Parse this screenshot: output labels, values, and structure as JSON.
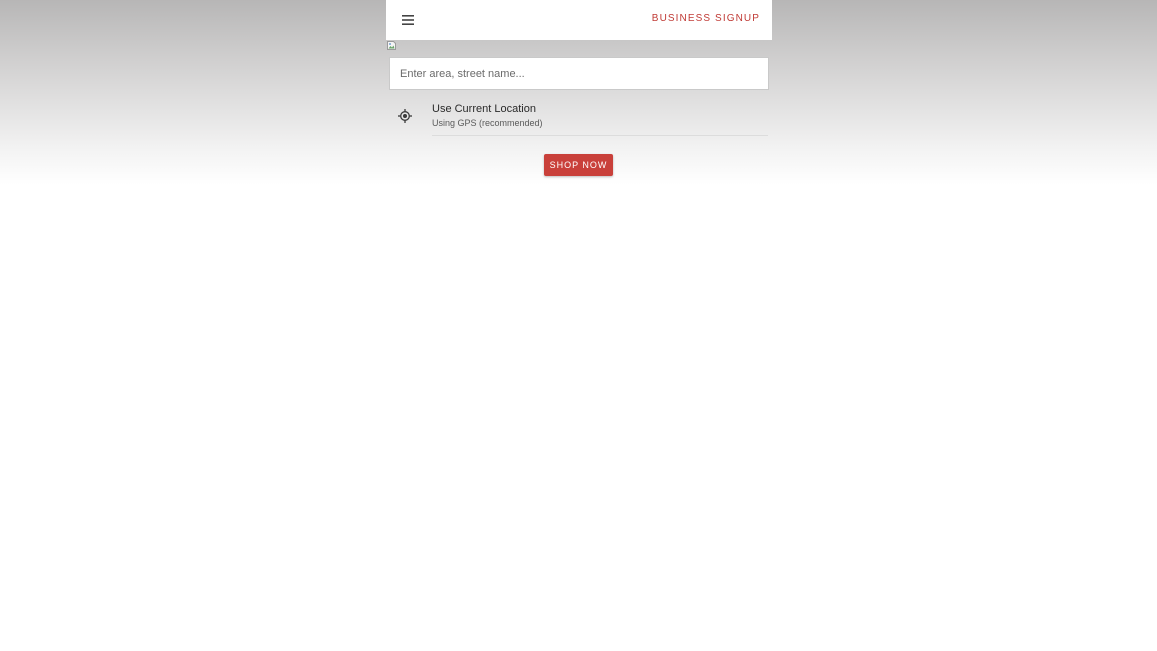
{
  "header": {
    "menu_icon": "menu-icon",
    "business_signup_label": "Business Signup"
  },
  "logo": {
    "icon": "broken-image-icon"
  },
  "search": {
    "value": "",
    "placeholder": "Enter area, street name..."
  },
  "current_location": {
    "icon": "gps-target-icon",
    "title": "Use Current Location",
    "subtitle": "Using GPS (recommended)"
  },
  "actions": {
    "shop_now_label": "Shop Now"
  },
  "colors": {
    "accent": "#c9403a",
    "link": "#c03a35",
    "header_bg": "#ffffff",
    "page_gradient_top": "#b7b6b6"
  }
}
